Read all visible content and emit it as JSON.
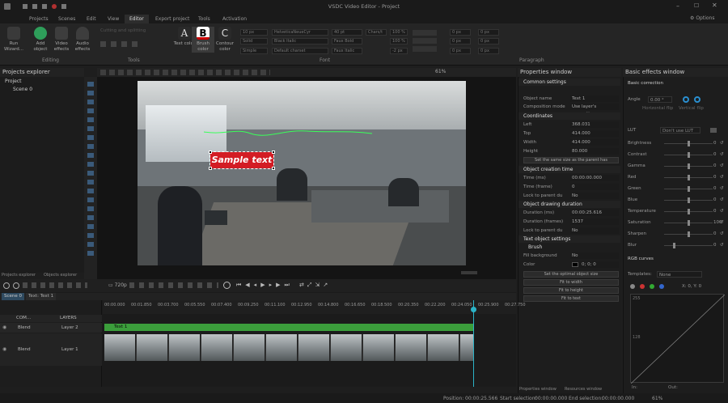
{
  "title": "VSDC Video Editor - Project",
  "menu": [
    "Projects",
    "Scenes",
    "Edit",
    "View",
    "Editor",
    "Export project",
    "Tools",
    "Activation"
  ],
  "options_label": "Options",
  "ribbon": {
    "run_wizard": "Run Wizard...",
    "add_object": "Add object",
    "video_effects": "Video effects",
    "audio_effects": "Audio effects",
    "cutting_splitting": "Cutting and splitting",
    "text_color": "Text color",
    "brush_color": "Brush color",
    "contour_color": "Contour color",
    "groups": {
      "editing": "Editing",
      "tools": "Tools",
      "font": "Font",
      "paragraph": "Paragraph"
    },
    "font": {
      "size1": "10 px",
      "weight1": "Solid",
      "style1": "Simple",
      "family": "HelveticaNeueCyr",
      "brush": "Black Italic",
      "charset": "Default charset",
      "size2": "40 pt",
      "faux_bold": "Faux Bold",
      "faux_italic": "Faux Italic",
      "chars": "Chars/t",
      "sz_a": "100 %",
      "sz_b": "100 %",
      "sz_c": "-2 px"
    },
    "paragraph": {
      "p1": "0 px",
      "p2": "0 px",
      "p3": "0 px",
      "p4": "0 px",
      "p5": "0 px",
      "p6": "0 px"
    }
  },
  "projects_explorer": {
    "title": "Projects explorer",
    "project": "Project",
    "scene": "Scene 0"
  },
  "bottom_tabs": {
    "projects": "Projects explorer",
    "objects": "Objects explorer"
  },
  "zoom": "61%",
  "sample_text": "Sample text",
  "properties": {
    "title": "Properties window",
    "common": "Common settings",
    "object_name_label": "Object name",
    "object_name": "Text 1",
    "composition_label": "Composition mode",
    "composition": "Use layer's properties",
    "coordinates": "Coordinates",
    "left_label": "Left",
    "left": "368.031",
    "top_label": "Top",
    "top": "414.000",
    "width_label": "Width",
    "width": "414.000",
    "height_label": "Height",
    "height": "80.000",
    "same_size": "Set the same size as the parent has",
    "creation_time": "Object creation time",
    "time_ms_label": "Time (ms)",
    "time_ms": "00:00:00.000",
    "time_frame_label": "Time (frame)",
    "time_frame": "0",
    "lock_label": "Lock to parent du",
    "lock": "No",
    "drawing_duration": "Object drawing duration",
    "duration_ms_label": "Duration (ms)",
    "duration_ms": "00:00:25.616",
    "duration_frames_label": "Duration (frames)",
    "duration_frames": "1537",
    "lock2_label": "Lock to parent du",
    "lock2": "No",
    "text_settings": "Text object settings",
    "brush": "Brush",
    "fill_label": "Fill background",
    "fill": "No",
    "color_label": "Color",
    "color": "0; 0; 0",
    "btn_optimal": "Set the optimal object size",
    "btn_width": "Fit to width",
    "btn_height": "Fit to height",
    "btn_text": "Fit to text",
    "tabs": [
      "Properties window",
      "Resources window"
    ]
  },
  "effects": {
    "title": "Basic effects window",
    "basic_correction": "Basic correction",
    "angle_label": "Angle",
    "angle": "0.00 °",
    "hflip": "Horizontal flip",
    "vflip": "Vertical flip",
    "lut_label": "LUT",
    "lut": "Don't use LUT",
    "sliders": [
      {
        "label": "Brightness",
        "value": "0",
        "level": 0.5
      },
      {
        "label": "Contrast",
        "value": "0",
        "level": 0.5
      },
      {
        "label": "Gamma",
        "value": "0",
        "level": 0.5
      },
      {
        "label": "Red",
        "value": "0",
        "level": 0.5
      },
      {
        "label": "Green",
        "value": "0",
        "level": 0.5
      },
      {
        "label": "Blue",
        "value": "0",
        "level": 0.5
      },
      {
        "label": "Temperature",
        "value": "0",
        "level": 0.5
      },
      {
        "label": "Saturation",
        "value": "100",
        "level": 0.5
      },
      {
        "label": "Sharpen",
        "value": "0",
        "level": 0.5
      },
      {
        "label": "Blur",
        "value": "0",
        "level": 0.2
      }
    ],
    "rgb_curves": "RGB curves",
    "templates_label": "Templates:",
    "templates": "None",
    "coords": "X: 0, Y: 0",
    "curve_top": "255",
    "curve_mid": "128",
    "in_label": "In:",
    "out_label": "Out:",
    "zoom": "61%"
  },
  "timeline": {
    "quality": "720p",
    "scene_tab": "Scene 0",
    "text_tab": "Text: Text 1",
    "comp_label": "COM...",
    "layers_label": "LAYERS",
    "ruler": [
      "00:00.000",
      "00:01.850",
      "00:03.700",
      "00:05.550",
      "00:07.400",
      "00:09.250",
      "00:11.100",
      "00:12.950",
      "00:14.800",
      "00:16.650",
      "00:18.500",
      "00:20.350",
      "00:22.200",
      "00:24.050",
      "00:25.900",
      "00:27.750"
    ],
    "tracks": [
      {
        "blend": "Blend",
        "layer": "Layer 2",
        "clip": "Text 1"
      },
      {
        "blend": "Blend",
        "layer": "Layer 1"
      }
    ]
  },
  "status": {
    "position_label": "Position:",
    "position": "00:00:25.566",
    "start_label": "Start selection:",
    "start": "00:00:00.000",
    "end_label": "End selection:",
    "end": "00:00:00.000",
    "zoom": "61%"
  }
}
